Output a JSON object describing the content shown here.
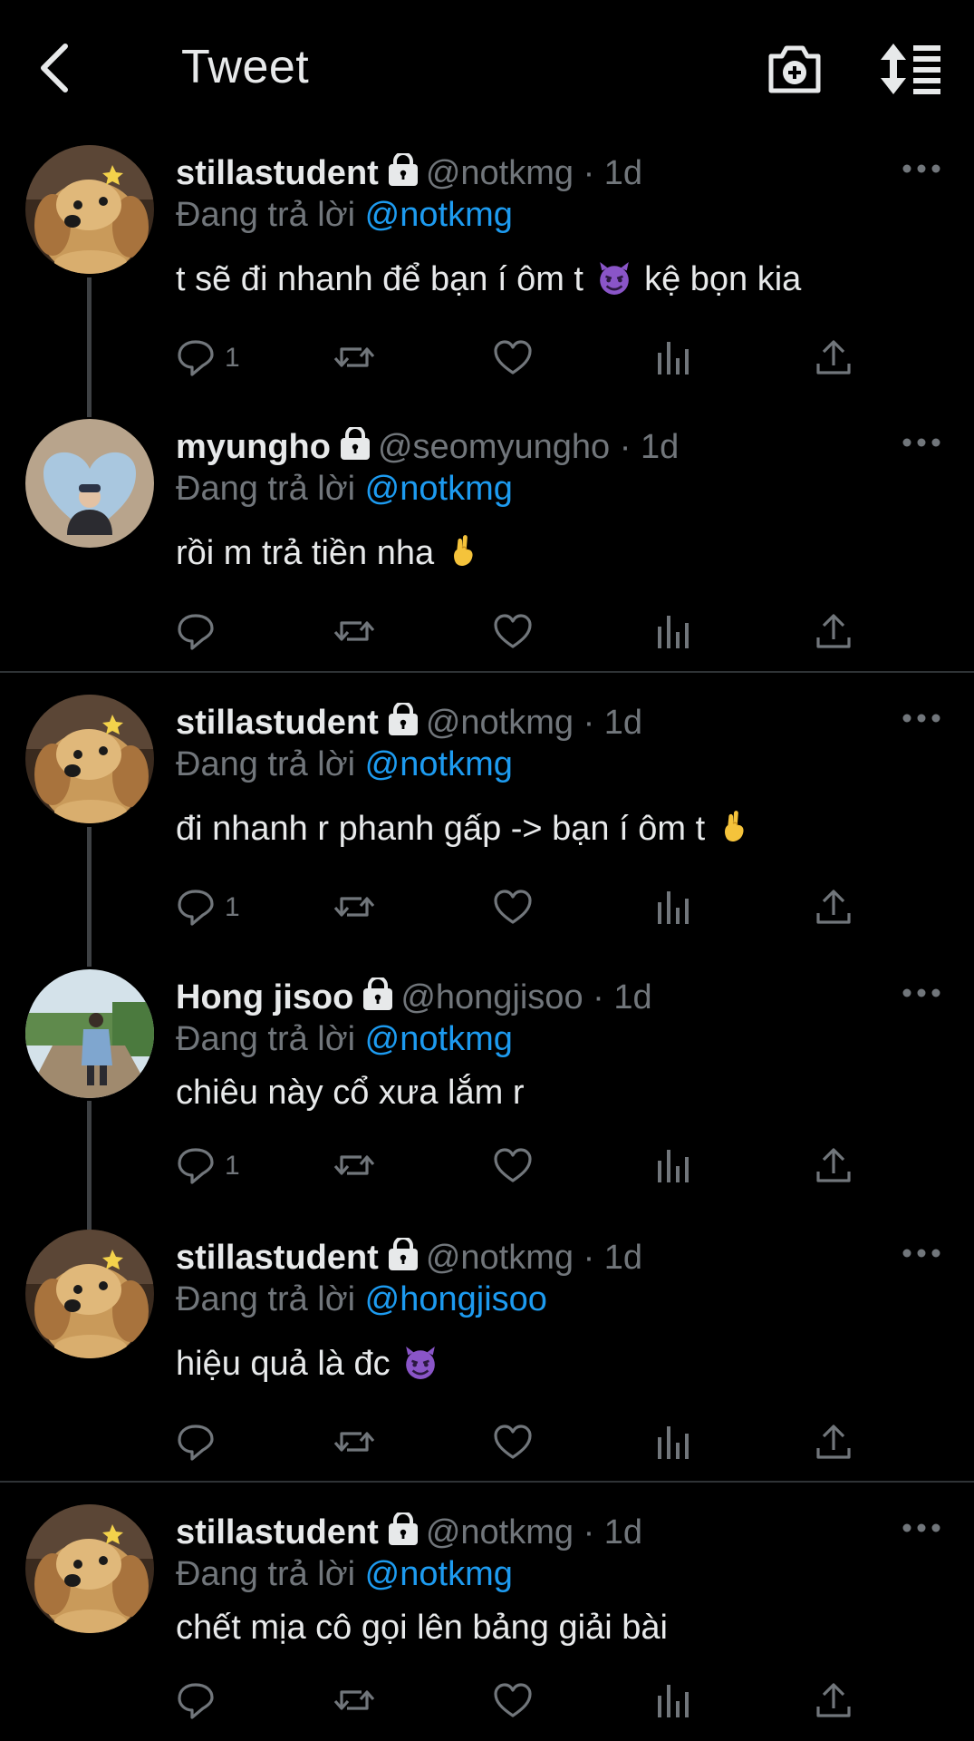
{
  "header": {
    "title": "Tweet",
    "back_icon": "chevron-left-icon",
    "camera_icon": "camera-plus-icon",
    "sort_icon": "sort-list-icon"
  },
  "colors": {
    "background": "#000000",
    "text": "#e7e9ea",
    "muted": "#71767b",
    "mention": "#1d9bf0",
    "divider": "#2f3336"
  },
  "reply_prefix": "Đang trả lời",
  "tweets": [
    {
      "name": "stillastudent",
      "handle": "@notkmg",
      "time": "1d",
      "reply_to": "@notkmg",
      "text_before": "t sẽ đi nhanh để bạn í ôm t",
      "emoji": "smiling-imp-emoji",
      "text_after": "kệ bọn kia",
      "reply_count": "1",
      "avatar": "dog-avatar"
    },
    {
      "name": "myungho",
      "handle": "@seomyungho",
      "time": "1d",
      "reply_to": "@notkmg",
      "text_before": "rồi m trả tiền nha",
      "emoji": "crossed-fingers-emoji",
      "text_after": "",
      "reply_count": "",
      "avatar": "person-heart-avatar"
    },
    {
      "name": "stillastudent",
      "handle": "@notkmg",
      "time": "1d",
      "reply_to": "@notkmg",
      "text_before": "đi nhanh r phanh gấp -> bạn í ôm t",
      "emoji": "crossed-fingers-emoji",
      "text_after": "",
      "reply_count": "1",
      "avatar": "dog-avatar"
    },
    {
      "name": "Hong jisoo",
      "handle": "@hongjisoo",
      "time": "1d",
      "reply_to": "@notkmg",
      "text_before": "chiêu này cổ xưa lắm r",
      "emoji": "",
      "text_after": "",
      "reply_count": "1",
      "avatar": "person-outdoor-avatar"
    },
    {
      "name": "stillastudent",
      "handle": "@notkmg",
      "time": "1d",
      "reply_to": "@hongjisoo",
      "text_before": "hiệu quả là đc",
      "emoji": "smiling-imp-emoji",
      "text_after": "",
      "reply_count": "",
      "avatar": "dog-avatar"
    },
    {
      "name": "stillastudent",
      "handle": "@notkmg",
      "time": "1d",
      "reply_to": "@notkmg",
      "text_before": "chết mịa cô gọi lên bảng giải bài",
      "emoji": "",
      "text_after": "",
      "reply_count": "",
      "avatar": "dog-avatar"
    }
  ]
}
